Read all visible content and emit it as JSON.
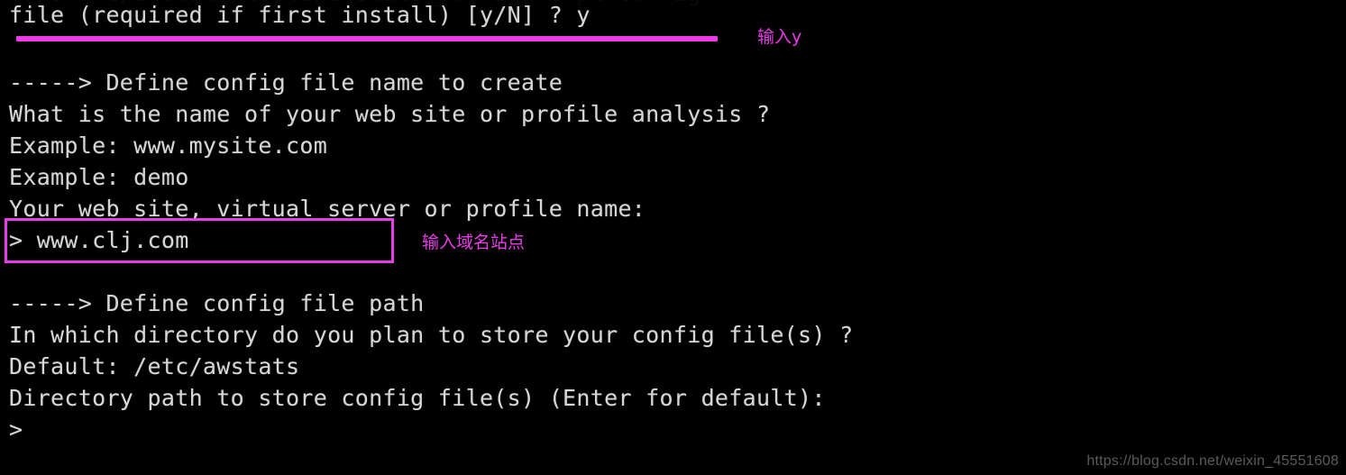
{
  "terminal": {
    "background_color": "#000000",
    "text_color": "#d6d6d6",
    "lines": [
      {
        "text": "sr/share/awstats/tools/awstats_configure.pl config",
        "clipped": true
      },
      {
        "text": "file (required if first install) [y/N] ? y"
      },
      {
        "text": ""
      },
      {
        "text": "-----> Define config file name to create"
      },
      {
        "text": "What is the name of your web site or profile analysis ?"
      },
      {
        "text": "Example: www.mysite.com"
      },
      {
        "text": "Example: demo"
      },
      {
        "text": "Your web site, virtual server or profile name:"
      },
      {
        "text": "> www.clj.com"
      },
      {
        "text": ""
      },
      {
        "text": "-----> Define config file path"
      },
      {
        "text": "In which directory do you plan to store your config file(s) ?"
      },
      {
        "text": "Default: /etc/awstats"
      },
      {
        "text": "Directory path to store config file(s) (Enter for default):"
      },
      {
        "text": ">"
      }
    ],
    "prompt_symbol": ">",
    "input_value": "www.clj.com",
    "answer_value": "y",
    "default_path": "/etc/awstats"
  },
  "annotations": {
    "color": "#e93ce9",
    "items": [
      {
        "label": "输入y"
      },
      {
        "label": "输入域名站点"
      }
    ]
  },
  "watermark": {
    "text": "https://blog.csdn.net/weixin_45551608",
    "color": "#5a5a5a"
  }
}
